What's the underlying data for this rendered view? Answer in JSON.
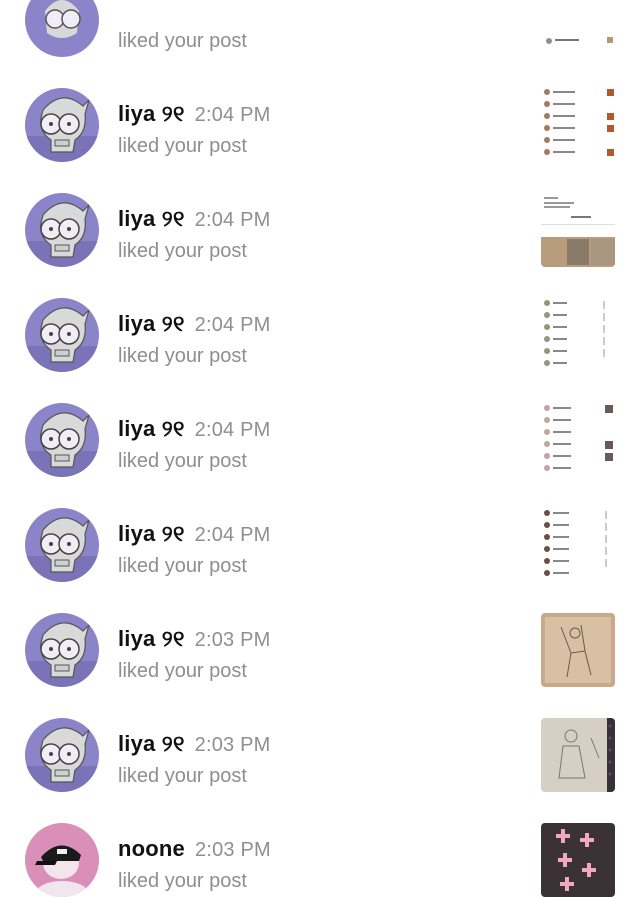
{
  "notifications": [
    {
      "user": "",
      "time": "",
      "action": "liked your post",
      "avatar": "alien-avatar",
      "thumbnail": "screenshot-list"
    },
    {
      "user": "liya ୨୧",
      "time": "2:04 PM",
      "action": "liked your post",
      "avatar": "alien-avatar",
      "thumbnail": "screenshot-list"
    },
    {
      "user": "liya ୨୧",
      "time": "2:04 PM",
      "action": "liked your post",
      "avatar": "alien-avatar",
      "thumbnail": "screenshot-profile"
    },
    {
      "user": "liya ୨୧",
      "time": "2:04 PM",
      "action": "liked your post",
      "avatar": "alien-avatar",
      "thumbnail": "screenshot-list"
    },
    {
      "user": "liya ୨୧",
      "time": "2:04 PM",
      "action": "liked your post",
      "avatar": "alien-avatar",
      "thumbnail": "screenshot-list"
    },
    {
      "user": "liya ୨୧",
      "time": "2:04 PM",
      "action": "liked your post",
      "avatar": "alien-avatar",
      "thumbnail": "screenshot-list"
    },
    {
      "user": "liya ୨୧",
      "time": "2:03 PM",
      "action": "liked your post",
      "avatar": "alien-avatar",
      "thumbnail": "sketch-photo"
    },
    {
      "user": "liya ୨୧",
      "time": "2:03 PM",
      "action": "liked your post",
      "avatar": "alien-avatar",
      "thumbnail": "sketch-photo"
    },
    {
      "user": "noone",
      "time": "2:03 PM",
      "action": "liked your post",
      "avatar": "cap-avatar",
      "thumbnail": "cross-pattern-photo"
    }
  ],
  "colors": {
    "avatar_bg": "#8b84c9",
    "noone_bg": "#d98fb8",
    "text": "#111111",
    "secondary": "#8e8e93"
  }
}
